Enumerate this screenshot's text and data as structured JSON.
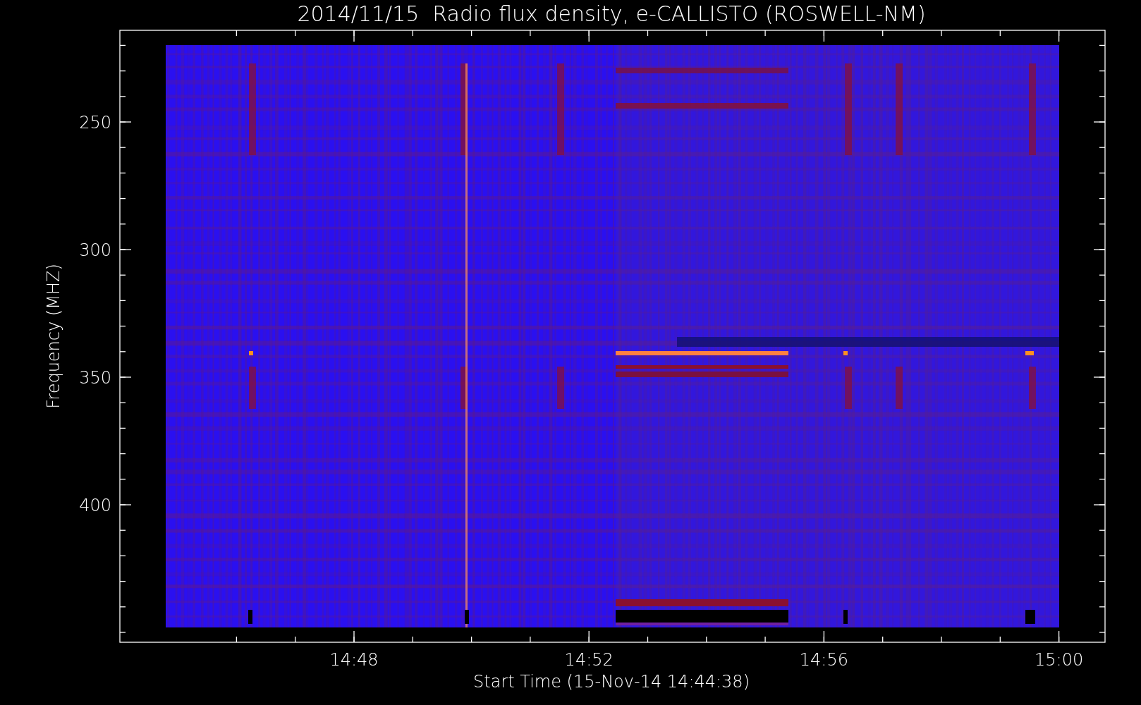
{
  "title": "2014/11/15  Radio flux density, e-CALLISTO (ROSWELL-NM)",
  "plot": {
    "ylabel": "Frequency (MHZ)",
    "xlabel": "Start Time (15-Nov-14 14:44:38)",
    "yticks": [
      "250",
      "300",
      "350",
      "400"
    ],
    "xticks": [
      "14:48",
      "14:52",
      "14:56",
      "15:00"
    ]
  }
}
